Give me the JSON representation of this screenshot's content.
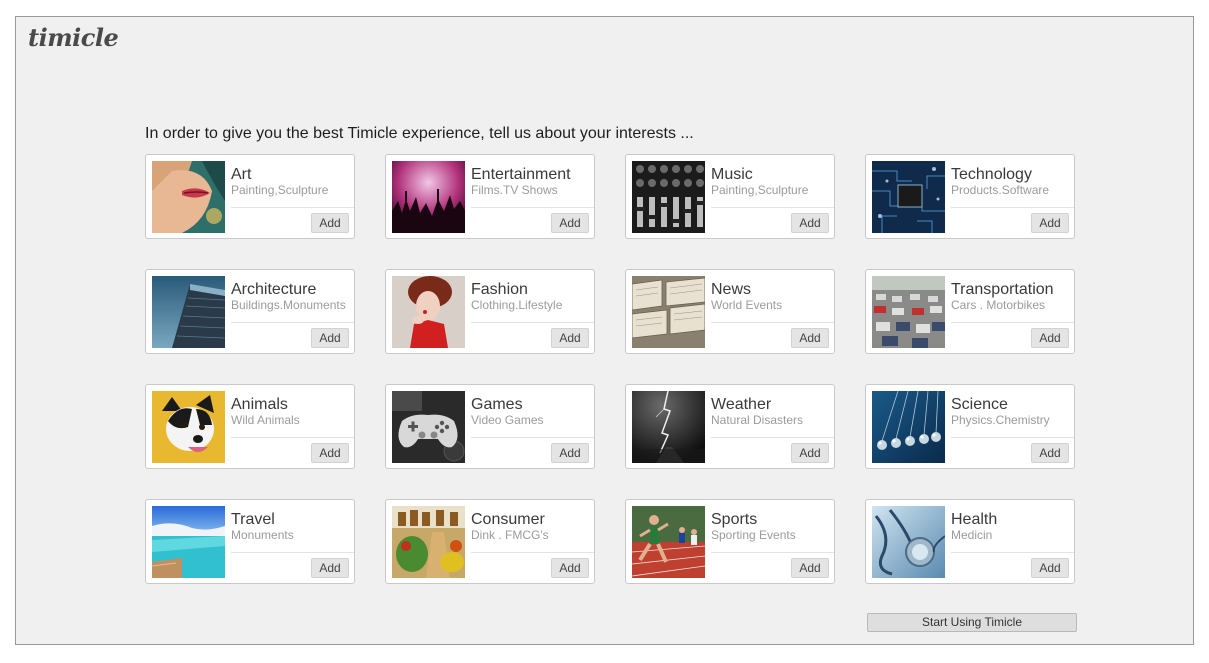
{
  "app": {
    "logo_text": "timicle"
  },
  "intro_text": "In order to give you the best Timicle experience, tell us about your interests ...",
  "add_label": "Add",
  "start_button_label": "Start Using Timicle",
  "interests": [
    {
      "title": "Art",
      "subtitle": "Painting,Sculpture",
      "icon": "art-portrait-image"
    },
    {
      "title": "Entertainment",
      "subtitle": "Films.TV Shows",
      "icon": "concert-crowd-image"
    },
    {
      "title": "Music",
      "subtitle": "Painting,Sculpture",
      "icon": "mixing-console-image"
    },
    {
      "title": "Technology",
      "subtitle": "Products.Software",
      "icon": "circuit-board-image"
    },
    {
      "title": "Architecture",
      "subtitle": "Buildings.Monuments",
      "icon": "skyscraper-image"
    },
    {
      "title": "Fashion",
      "subtitle": "Clothing.Lifestyle",
      "icon": "fashion-model-image"
    },
    {
      "title": "News",
      "subtitle": "World Events",
      "icon": "newspapers-image"
    },
    {
      "title": "Transportation",
      "subtitle": "Cars . Motorbikes",
      "icon": "traffic-image"
    },
    {
      "title": "Animals",
      "subtitle": "Wild Animals",
      "icon": "dog-image"
    },
    {
      "title": "Games",
      "subtitle": "Video Games",
      "icon": "game-controller-image"
    },
    {
      "title": "Weather",
      "subtitle": "Natural Disasters",
      "icon": "lightning-image"
    },
    {
      "title": "Science",
      "subtitle": "Physics.Chemistry",
      "icon": "newtons-cradle-image"
    },
    {
      "title": "Travel",
      "subtitle": "Monuments",
      "icon": "beach-pool-image"
    },
    {
      "title": "Consumer",
      "subtitle": "Dink . FMCG's",
      "icon": "grocery-image"
    },
    {
      "title": "Sports",
      "subtitle": "Sporting Events",
      "icon": "runners-image"
    },
    {
      "title": "Health",
      "subtitle": "Medicin",
      "icon": "stethoscope-image"
    }
  ]
}
